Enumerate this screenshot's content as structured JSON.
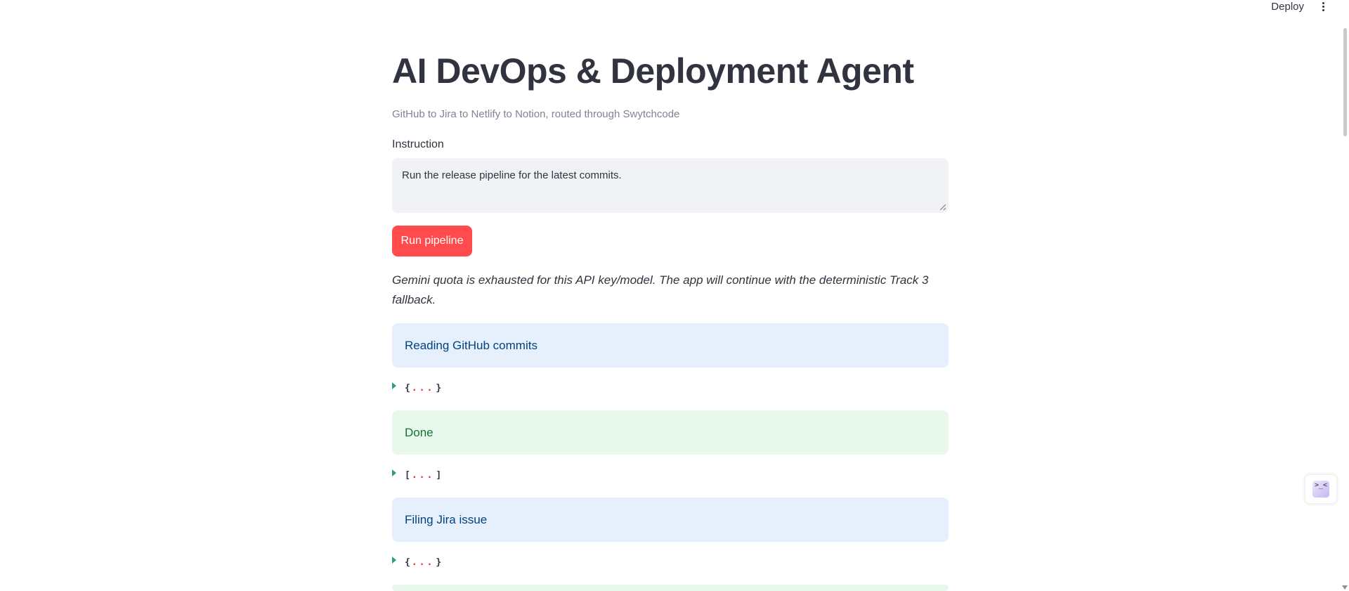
{
  "toolbar": {
    "deploy_label": "Deploy",
    "menu_icon": "kebab-menu-icon"
  },
  "header": {
    "title": "AI DevOps & Deployment Agent",
    "subtitle": "GitHub to Jira to Netlify to Notion, routed through Swytchcode"
  },
  "instruction": {
    "label": "Instruction",
    "value": "Run the release pipeline for the latest commits."
  },
  "run_button": {
    "label": "Run pipeline"
  },
  "notice": "Gemini quota is exhausted for this API key/model. The app will continue with the deterministic Track 3 fallback.",
  "steps": [
    {
      "type": "info",
      "text": "Reading GitHub commits",
      "json": {
        "open": "{",
        "ellipsis": "...",
        "close": "}"
      }
    },
    {
      "type": "success",
      "text": "Done",
      "json": {
        "open": "[",
        "ellipsis": "...",
        "close": "]"
      }
    },
    {
      "type": "info",
      "text": "Filing Jira issue",
      "json": {
        "open": "{",
        "ellipsis": "...",
        "close": "}"
      }
    },
    {
      "type": "success",
      "text": ""
    }
  ],
  "side_widget": {
    "icon": "terminal-icon",
    "glyph": ">_<"
  },
  "colors": {
    "primary": "#ff4b4b",
    "info_bg": "#e6f0fc",
    "info_text": "#004280",
    "success_bg": "#e8f8ed",
    "success_text": "#177233"
  }
}
